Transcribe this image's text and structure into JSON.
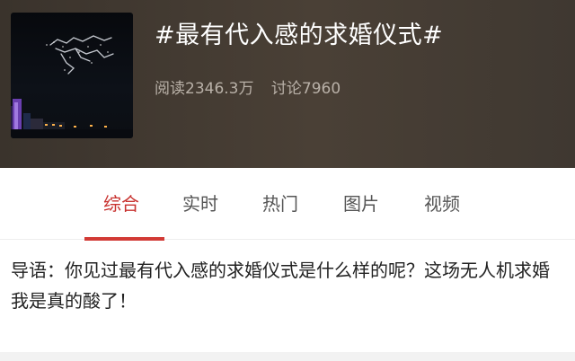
{
  "topic": {
    "title": "#最有代入感的求婚仪式#",
    "reads": "阅读2346.3万",
    "discussions": "讨论7960",
    "thumbnail_icon": "drone-light-show-image"
  },
  "tabs": [
    {
      "label": "综合",
      "active": true
    },
    {
      "label": "实时",
      "active": false
    },
    {
      "label": "热门",
      "active": false
    },
    {
      "label": "图片",
      "active": false
    },
    {
      "label": "视频",
      "active": false
    }
  ],
  "guide": {
    "text": "导语：你见过最有代入感的求婚仪式是什么样的呢？这场无人机求婚我是真的酸了！"
  },
  "colors": {
    "accent": "#d23a35",
    "header_bg": "#443b33"
  }
}
